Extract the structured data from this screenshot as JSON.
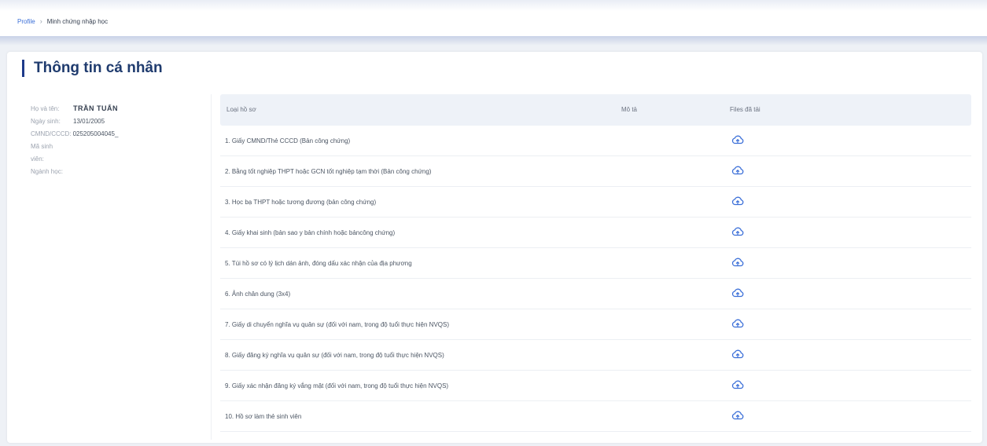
{
  "breadcrumb": {
    "home": "Profile",
    "current": "Minh chứng nhập học"
  },
  "section": {
    "title": "Thông tin cá nhân"
  },
  "profile": {
    "name_label": "Họ và tên:",
    "name_value": "TRẦN TUẤN",
    "dob_label": "Ngày sinh:",
    "dob_value": "13/01/2005",
    "id_label": "CMND/CCCD:",
    "id_value": "025205004045_",
    "student_id_label_1": "Mã sinh",
    "student_id_label_2": "viên:",
    "major_label": "Ngành học:"
  },
  "table": {
    "headers": [
      "Loại hồ sơ",
      "Mô tả",
      "Files đã tải"
    ],
    "rows": [
      "1. Giấy CMND/Thẻ CCCD (Bản công chứng)",
      "2. Bằng tốt nghiệp THPT hoặc GCN tốt nghiệp tạm thời (Bản công chứng)",
      "3. Học bạ THPT hoặc tương đương (bản công chứng)",
      "4. Giấy khai sinh (bản sao y bản chính hoặc bảncông chứng)",
      "5. Túi hồ sơ có lý lịch dán ảnh, đóng dấu xác nhận của địa phương",
      "6. Ảnh chân dung (3x4)",
      "7. Giấy di chuyển nghĩa vụ quân sự (đối với nam, trong độ tuổi thực hiện NVQS)",
      "8. Giấy đăng ký nghĩa vụ quân sự (đối với nam, trong độ tuổi thực hiện NVQS)",
      "9. Giấy xác nhận đăng ký vắng mặt (đối với nam, trong độ tuổi thực hiện NVQS)",
      "10. Hồ sơ làm thẻ sinh viên"
    ]
  },
  "icons": {
    "upload": "cloud-upload-icon"
  },
  "colors": {
    "accent": "#3b6fd8",
    "title": "#1f3b6e",
    "header_bg": "#eef2f8"
  }
}
